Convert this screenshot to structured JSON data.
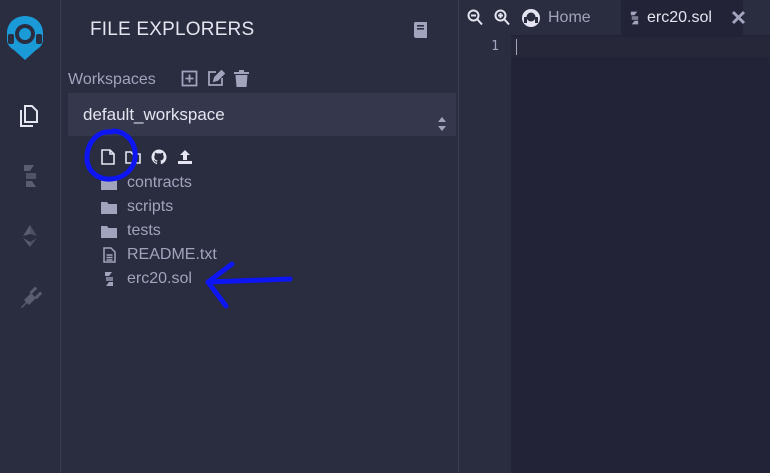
{
  "sidebar": {
    "title": "FILE EXPLORERS",
    "workspaces_label": "Workspaces",
    "selected_workspace": "default_workspace",
    "workspace_actions": [
      "create-workspace-icon",
      "rename-workspace-icon",
      "delete-workspace-icon"
    ],
    "file_actions": [
      "new-file-icon",
      "new-folder-icon",
      "github-icon",
      "upload-icon"
    ],
    "tree": [
      {
        "label": "contracts",
        "icon": "folder-icon"
      },
      {
        "label": "scripts",
        "icon": "folder-icon"
      },
      {
        "label": "tests",
        "icon": "folder-icon"
      },
      {
        "label": "README.txt",
        "icon": "text-file-icon"
      },
      {
        "label": "erc20.sol",
        "icon": "solidity-icon"
      }
    ]
  },
  "iconbar": {
    "items": [
      "logo-icon",
      "file-explorer-icon",
      "solidity-compiler-icon",
      "deploy-run-icon",
      "plugin-manager-icon"
    ]
  },
  "editor": {
    "tabs": [
      {
        "label": "Home",
        "icon": "home-icon"
      },
      {
        "label": "erc20.sol",
        "icon": "solidity-icon",
        "active": true
      }
    ],
    "line_numbers": [
      "1"
    ]
  },
  "colors": {
    "annotation": "#0d16f2",
    "panel": "#2a2c3f",
    "editor": "#222336"
  }
}
